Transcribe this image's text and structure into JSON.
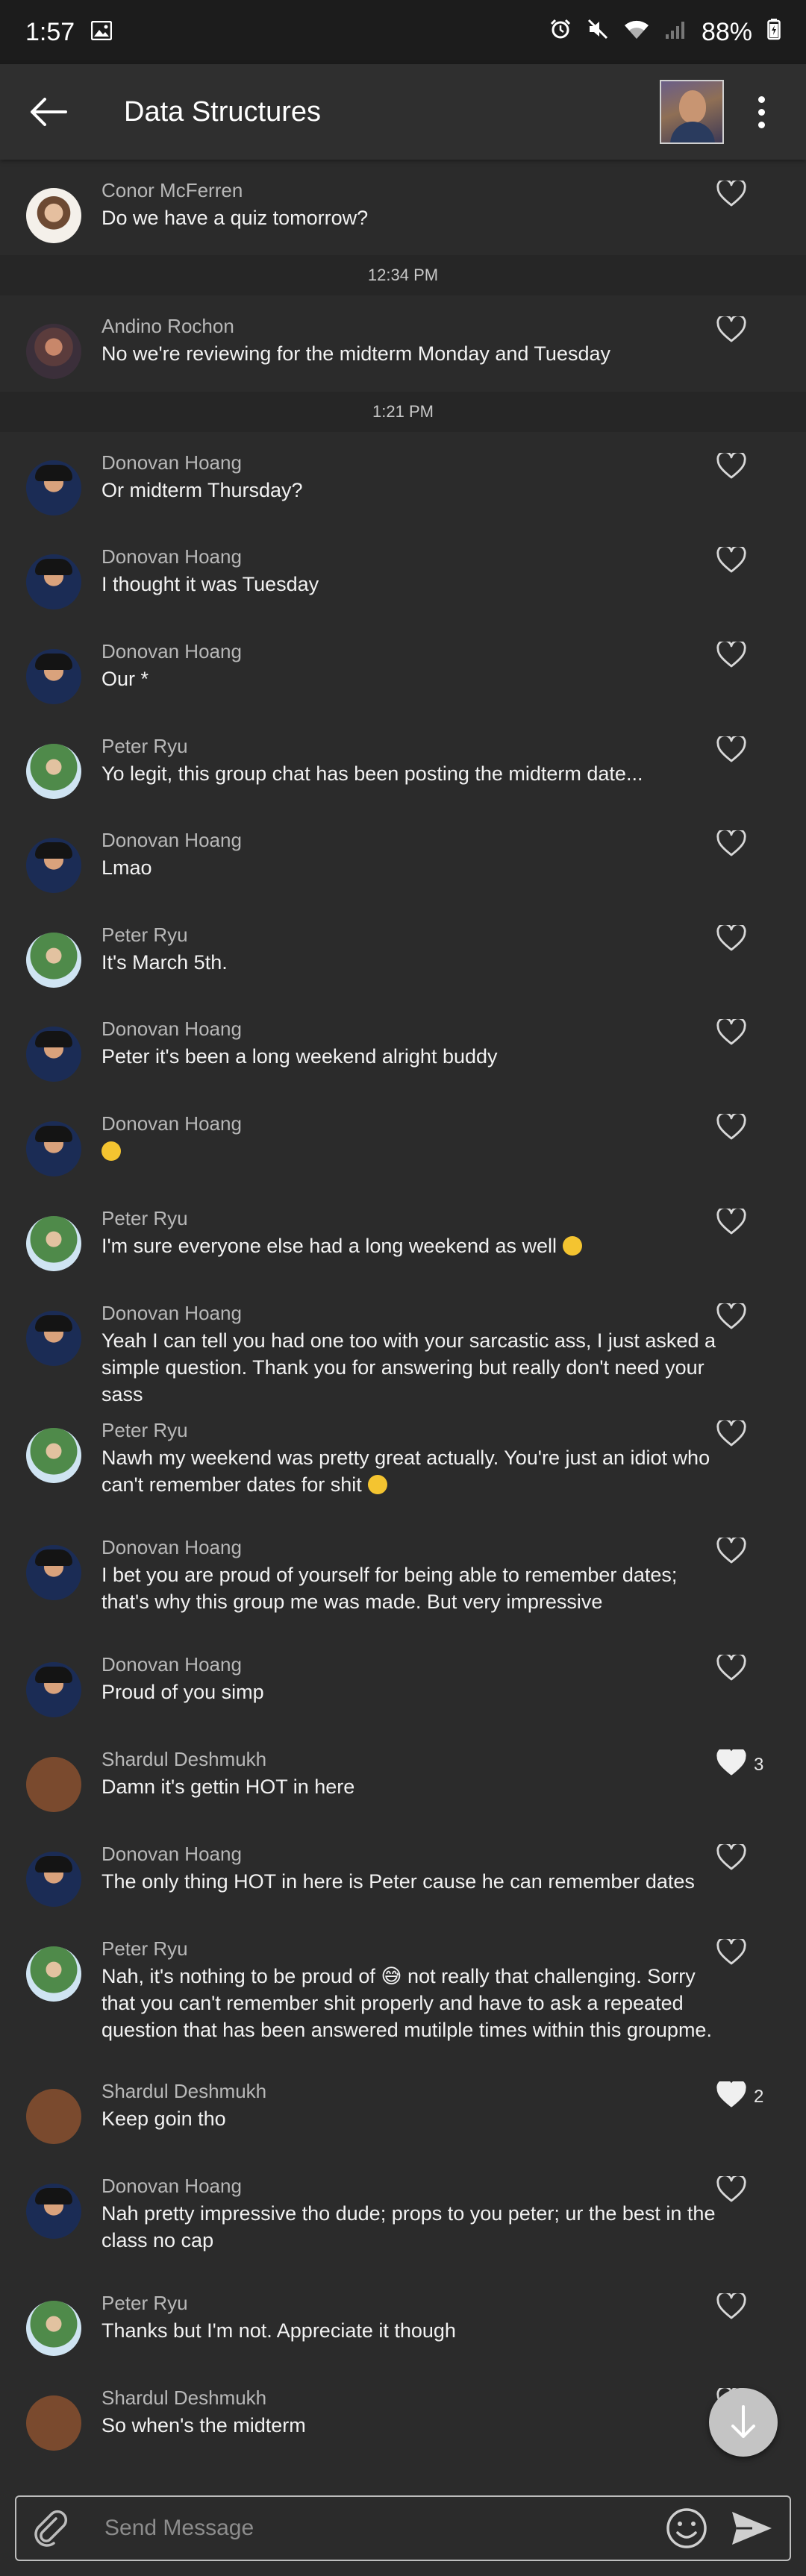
{
  "status_bar": {
    "time": "1:57",
    "battery": "88%"
  },
  "header": {
    "title": "Data Structures"
  },
  "messages": [
    {
      "type": "msg",
      "name": "Conor McFerren",
      "text": "Do we have a quiz tomorrow?",
      "avatar": "conor",
      "likes": "",
      "liked": false
    },
    {
      "type": "time",
      "text": "12:34 PM"
    },
    {
      "type": "msg",
      "name": "Andino Rochon",
      "text": "No we're reviewing for the midterm Monday and Tuesday",
      "avatar": "andino",
      "likes": "",
      "liked": false
    },
    {
      "type": "time",
      "text": "1:21 PM"
    },
    {
      "type": "msg",
      "name": "Donovan Hoang",
      "text": "Or midterm Thursday?",
      "avatar": "donovan",
      "likes": "",
      "liked": false
    },
    {
      "type": "msg",
      "name": "Donovan Hoang",
      "text": "I thought it was Tuesday",
      "avatar": "donovan",
      "likes": "",
      "liked": false
    },
    {
      "type": "msg",
      "name": "Donovan Hoang",
      "text": "Our *",
      "avatar": "donovan",
      "likes": "",
      "liked": false
    },
    {
      "type": "msg",
      "name": "Peter Ryu",
      "text": "Yo legit, this group chat has been posting the midterm date...",
      "avatar": "peter",
      "likes": "",
      "liked": false
    },
    {
      "type": "msg",
      "name": "Donovan Hoang",
      "text": "Lmao",
      "avatar": "donovan",
      "likes": "",
      "liked": false
    },
    {
      "type": "msg",
      "name": "Peter Ryu",
      "text": "It's March 5th.",
      "avatar": "peter",
      "likes": "",
      "liked": false
    },
    {
      "type": "msg",
      "name": "Donovan Hoang",
      "text": "Peter it's been a long weekend alright buddy",
      "avatar": "donovan",
      "likes": "",
      "liked": false
    },
    {
      "type": "msg",
      "name": "Donovan Hoang",
      "text": "",
      "emoji": "grinning-sweat-emoji",
      "avatar": "donovan",
      "likes": "",
      "liked": false
    },
    {
      "type": "msg",
      "name": "Peter Ryu",
      "text": "I'm sure everyone else had a long weekend as well",
      "emoji": "slightly-frowning-emoji",
      "avatar": "peter",
      "likes": "",
      "liked": false
    },
    {
      "type": "msg",
      "name": "Donovan Hoang",
      "text": "Yeah I can tell you had one too with your sarcastic ass, I just asked a simple question. Thank you for answering but really don't need your sass",
      "avatar": "donovan",
      "likes": "",
      "liked": false
    },
    {
      "type": "msg",
      "name": "Peter Ryu",
      "text": "Nawh my weekend was pretty great actually. You're just an idiot who can't remember dates for shit",
      "emoji": "crying-emoji",
      "avatar": "peter",
      "likes": "",
      "liked": false
    },
    {
      "type": "msg",
      "name": "Donovan Hoang",
      "text": "I bet you are proud of yourself for being able to remember dates; that's why this group me was made. But very impressive",
      "avatar": "donovan",
      "likes": "",
      "liked": false
    },
    {
      "type": "msg",
      "name": "Donovan Hoang",
      "text": "Proud of you simp",
      "avatar": "donovan",
      "likes": "",
      "liked": false
    },
    {
      "type": "msg",
      "name": "Shardul Deshmukh",
      "text": "Damn it's gettin HOT in here",
      "avatar": "shardul",
      "likes": "3",
      "liked": true
    },
    {
      "type": "msg",
      "name": "Donovan Hoang",
      "text": "The only thing HOT in here is Peter cause he can remember dates",
      "avatar": "donovan",
      "likes": "",
      "liked": false
    },
    {
      "type": "msg",
      "name": "Peter Ryu",
      "text": "Nah, it's nothing to be proud of 😅 not really that challenging. Sorry that you can't remember shit properly and have to ask a repeated question that has been answered mutilple times within this groupme.",
      "avatar": "peter",
      "likes": "",
      "liked": false
    },
    {
      "type": "msg",
      "name": "Shardul Deshmukh",
      "text": "Keep goin tho",
      "avatar": "shardul",
      "likes": "2",
      "liked": true
    },
    {
      "type": "msg",
      "name": "Donovan Hoang",
      "text": "Nah pretty impressive tho dude; props to you peter; ur the best in the class no cap",
      "avatar": "donovan",
      "likes": "",
      "liked": false
    },
    {
      "type": "msg",
      "name": "Peter Ryu",
      "text": "Thanks but I'm not. Appreciate it though",
      "avatar": "peter",
      "likes": "",
      "liked": false
    },
    {
      "type": "msg",
      "name": "Shardul Deshmukh",
      "text": "So when's the midterm",
      "avatar": "shardul",
      "likes": "",
      "liked": false
    }
  ],
  "compose": {
    "placeholder": "Send Message"
  }
}
